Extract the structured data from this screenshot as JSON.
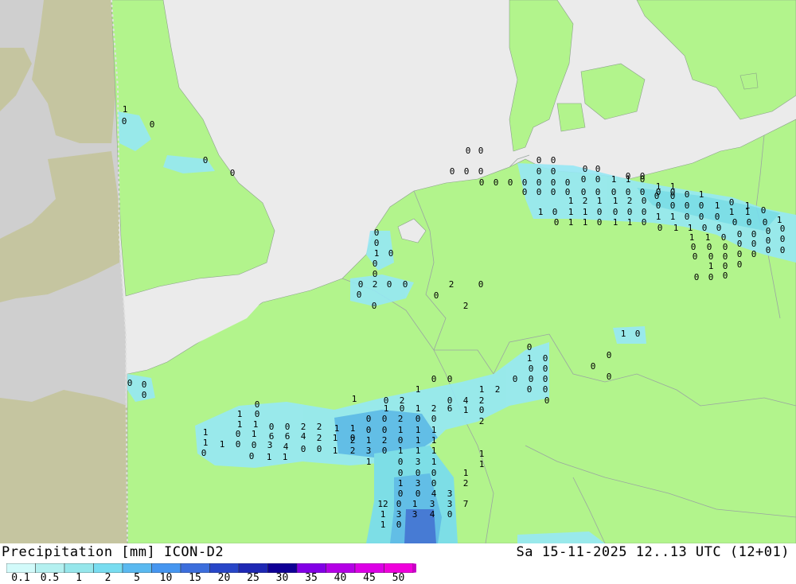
{
  "map": {
    "colors": {
      "sea": "#ebebeb",
      "land": "#b2f48c",
      "outside_domain_land": "#c5c5a0",
      "outside_domain_sea": "#cfcfcf",
      "border": "#9aa6a0",
      "precip_light": "#96e8f5",
      "precip_mid": "#5ab9f0",
      "precip_heavy": "#2d6ecc"
    },
    "value_labels": [
      "1",
      "0",
      "0",
      "0",
      "0",
      "0",
      "0",
      "0",
      "0",
      "0",
      "0",
      "0",
      "0",
      "0",
      "0",
      "0",
      "0",
      "0",
      "0",
      "0",
      "0",
      "0",
      "0",
      "0",
      "0",
      "0",
      "0",
      "0",
      "0",
      "0",
      "0",
      "0",
      "0",
      "0",
      "0",
      "0",
      "1",
      "1",
      "0",
      "0",
      "0",
      "1",
      "1",
      "0",
      "0",
      "0",
      "1",
      "1",
      "2",
      "1",
      "1",
      "2",
      "0",
      "0",
      "0",
      "0",
      "0",
      "1",
      "0",
      "1",
      "1",
      "0",
      "1",
      "1",
      "0",
      "0",
      "0",
      "0",
      "1",
      "1",
      "0",
      "0",
      "0",
      "1",
      "1",
      "0",
      "0",
      "1",
      "1",
      "0",
      "1",
      "1",
      "0",
      "0",
      "1",
      "1",
      "0",
      "0",
      "0",
      "0",
      "0",
      "1",
      "1",
      "1",
      "0",
      "0",
      "0",
      "0",
      "0",
      "0",
      "0",
      "0",
      "0",
      "0",
      "0",
      "0",
      "0",
      "0",
      "0",
      "0",
      "0",
      "0",
      "0",
      "1",
      "0",
      "0",
      "0",
      "0",
      "0",
      "0",
      "0",
      "1",
      "0",
      "0",
      "0",
      "0",
      "2",
      "0",
      "0",
      "0",
      "0",
      "0",
      "2",
      "2",
      "0",
      "1",
      "0",
      "0",
      "1",
      "0",
      "0",
      "0",
      "0",
      "0",
      "0",
      "0",
      "0",
      "0",
      "0",
      "0",
      "0",
      "0",
      "0",
      "0",
      "0",
      "1",
      "0",
      "1",
      "0",
      "2",
      "1",
      "0",
      "0",
      "1",
      "1",
      "0",
      "0",
      "2",
      "2",
      "1",
      "1",
      "0",
      "0",
      "2",
      "0",
      "0",
      "1",
      "0",
      "1",
      "2",
      "6",
      "4",
      "2",
      "1",
      "2",
      "0",
      "1",
      "0",
      "2",
      "1",
      "0",
      "1",
      "6",
      "6",
      "4",
      "2",
      "1",
      "0",
      "0",
      "0",
      "1",
      "1",
      "1",
      "1",
      "1",
      "0",
      "0",
      "3",
      "4",
      "2",
      "1",
      "2",
      "0",
      "1",
      "1",
      "0",
      "0",
      "1",
      "1",
      "0",
      "0",
      "1",
      "2",
      "3",
      "0",
      "1",
      "1",
      "1",
      "1",
      "0",
      "3",
      "1",
      "1",
      "1",
      "0",
      "0",
      "0",
      "1",
      "2",
      "1",
      "3",
      "0",
      "0",
      "0",
      "4",
      "3",
      "12",
      "0",
      "1",
      "3",
      "3",
      "7",
      "1",
      "3",
      "3",
      "4",
      "0",
      "1",
      "0"
    ]
  },
  "footer": {
    "title_left": "Precipitation [mm] ICON-D2",
    "title_right": "Sa 15-11-2025 12..13 UTC (12+01)",
    "legend": {
      "labels": [
        "0.1",
        "0.5",
        "1",
        "2",
        "5",
        "10",
        "15",
        "20",
        "25",
        "30",
        "35",
        "40",
        "45",
        "50"
      ],
      "colors": [
        "#d2fafa",
        "#b4f0f0",
        "#96e6eb",
        "#78dcf0",
        "#5ab9f0",
        "#4696f0",
        "#3c6edc",
        "#2846c8",
        "#1e28b4",
        "#0f0096",
        "#8200e6",
        "#b400e6",
        "#dc00e6",
        "#f000dc",
        "#c800c8"
      ]
    }
  }
}
